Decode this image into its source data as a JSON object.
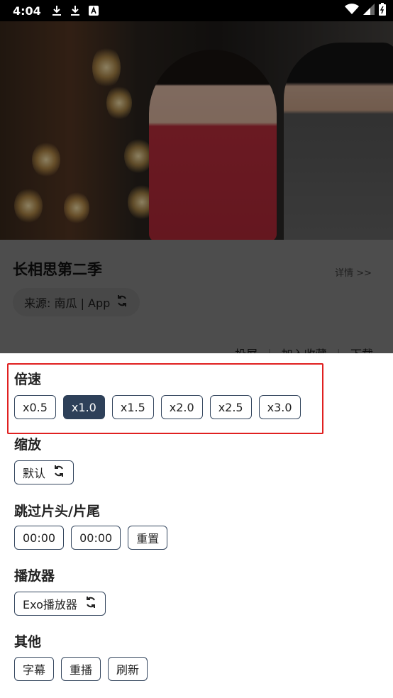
{
  "status_bar": {
    "time": "4:04"
  },
  "video": {
    "title": "长相思第二季"
  },
  "info": {
    "detail_label": "详情 >>",
    "source_label": "来源: 南瓜 | App",
    "actions": [
      "投屏",
      "加入收藏",
      "下载"
    ]
  },
  "speed": {
    "title": "倍速",
    "options": [
      "x0.5",
      "x1.0",
      "x1.5",
      "x2.0",
      "x2.5",
      "x3.0"
    ],
    "selected": "x1.0"
  },
  "zoom": {
    "title": "缩放",
    "value": "默认"
  },
  "skip": {
    "title": "跳过片头/片尾",
    "intro": "00:00",
    "outro": "00:00",
    "reset_label": "重置"
  },
  "player": {
    "title": "播放器",
    "value": "Exo播放器"
  },
  "other": {
    "title": "其他",
    "items": [
      "字幕",
      "重播",
      "刷新"
    ]
  },
  "colors": {
    "accent": "#2e4059",
    "highlight": "#e02020"
  }
}
